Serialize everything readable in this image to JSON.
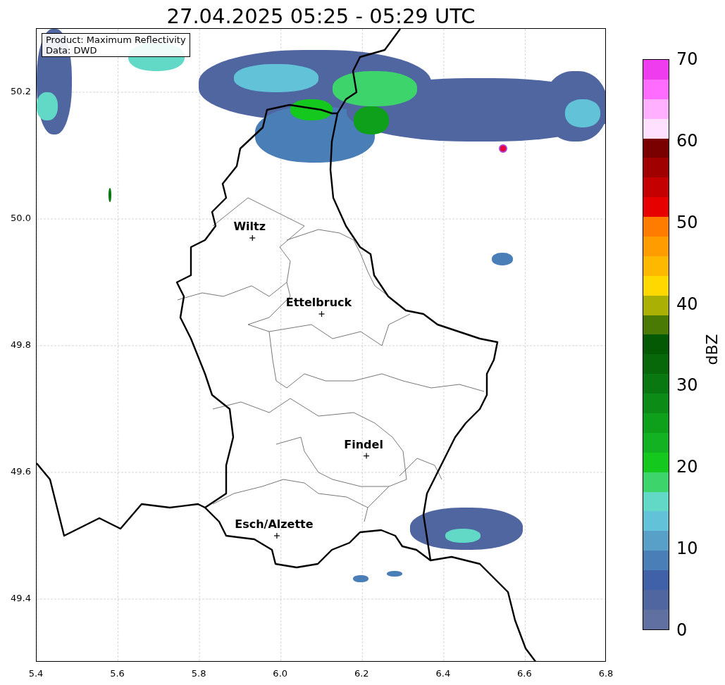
{
  "title": "27.04.2025 05:25 - 05:29 UTC",
  "legend": [
    "Product: Maximum Reflectivity",
    "Data: DWD"
  ],
  "cities": [
    {
      "name": "Wiltz"
    },
    {
      "name": "Ettelbruck"
    },
    {
      "name": "Findel"
    },
    {
      "name": "Esch/Alzette"
    }
  ],
  "x_axis": {
    "ticks": [
      "5.4",
      "5.6",
      "5.8",
      "6.0",
      "6.2",
      "6.4",
      "6.6",
      "6.8"
    ]
  },
  "y_axis": {
    "ticks": [
      "50.2",
      "50.0",
      "49.8",
      "49.6",
      "49.4"
    ]
  },
  "colorbar": {
    "label": "dBZ",
    "ticks": [
      "70",
      "60",
      "50",
      "40",
      "30",
      "20",
      "10",
      "0"
    ],
    "bands": [
      {
        "color": "#ee3cee"
      },
      {
        "color": "#ff6cff"
      },
      {
        "color": "#ffb0ff"
      },
      {
        "color": "#ffe0ff"
      },
      {
        "color": "#7a0000"
      },
      {
        "color": "#a00000"
      },
      {
        "color": "#c40000"
      },
      {
        "color": "#e60000"
      },
      {
        "color": "#ff7c00"
      },
      {
        "color": "#ff9c00"
      },
      {
        "color": "#ffb800"
      },
      {
        "color": "#ffd800"
      },
      {
        "color": "#aab004"
      },
      {
        "color": "#4a7a04"
      },
      {
        "color": "#045a04"
      },
      {
        "color": "#066808"
      },
      {
        "color": "#0a7810"
      },
      {
        "color": "#0c8c16"
      },
      {
        "color": "#0ea01a"
      },
      {
        "color": "#12b222"
      },
      {
        "color": "#14c81e"
      },
      {
        "color": "#3ed46c"
      },
      {
        "color": "#62d8c6"
      },
      {
        "color": "#62c2d8"
      },
      {
        "color": "#58a0c8"
      },
      {
        "color": "#4a7eb6"
      },
      {
        "color": "#4060a8"
      },
      {
        "color": "#5066a0"
      },
      {
        "color": "#6070a0"
      }
    ]
  }
}
